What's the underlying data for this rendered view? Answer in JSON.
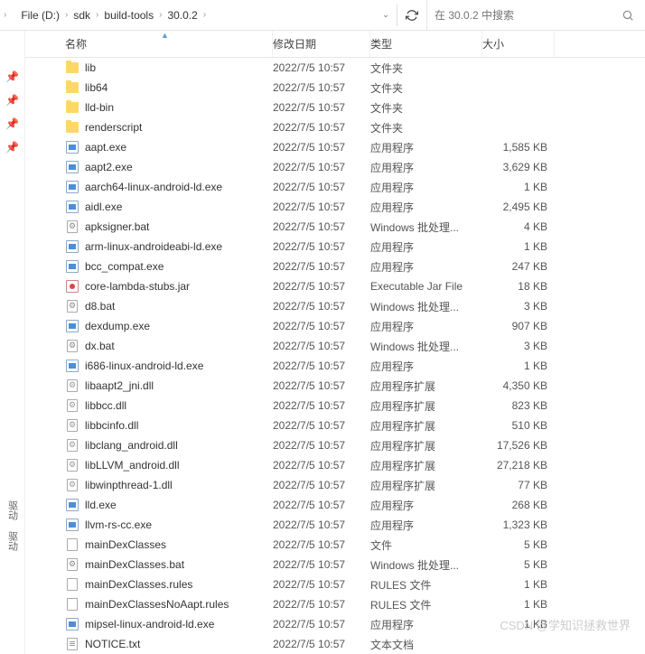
{
  "breadcrumb": [
    "File (D:)",
    "sdk",
    "build-tools",
    "30.0.2"
  ],
  "search": {
    "placeholder": "在 30.0.2 中搜索"
  },
  "columns": {
    "name": "名称",
    "date": "修改日期",
    "type": "类型",
    "size": "大小"
  },
  "quickaccess": {
    "label1": "驱动",
    "label2": "驱动"
  },
  "watermark": "CSDN @学知识拯救世界",
  "files": [
    {
      "icon": "folder",
      "name": "lib",
      "date": "2022/7/5 10:57",
      "type": "文件夹",
      "size": ""
    },
    {
      "icon": "folder",
      "name": "lib64",
      "date": "2022/7/5 10:57",
      "type": "文件夹",
      "size": ""
    },
    {
      "icon": "folder",
      "name": "lld-bin",
      "date": "2022/7/5 10:57",
      "type": "文件夹",
      "size": ""
    },
    {
      "icon": "folder",
      "name": "renderscript",
      "date": "2022/7/5 10:57",
      "type": "文件夹",
      "size": ""
    },
    {
      "icon": "exe",
      "name": "aapt.exe",
      "date": "2022/7/5 10:57",
      "type": "应用程序",
      "size": "1,585 KB"
    },
    {
      "icon": "exe",
      "name": "aapt2.exe",
      "date": "2022/7/5 10:57",
      "type": "应用程序",
      "size": "3,629 KB"
    },
    {
      "icon": "exe",
      "name": "aarch64-linux-android-ld.exe",
      "date": "2022/7/5 10:57",
      "type": "应用程序",
      "size": "1 KB"
    },
    {
      "icon": "exe",
      "name": "aidl.exe",
      "date": "2022/7/5 10:57",
      "type": "应用程序",
      "size": "2,495 KB"
    },
    {
      "icon": "bat",
      "name": "apksigner.bat",
      "date": "2022/7/5 10:57",
      "type": "Windows 批处理...",
      "size": "4 KB"
    },
    {
      "icon": "exe",
      "name": "arm-linux-androideabi-ld.exe",
      "date": "2022/7/5 10:57",
      "type": "应用程序",
      "size": "1 KB"
    },
    {
      "icon": "exe",
      "name": "bcc_compat.exe",
      "date": "2022/7/5 10:57",
      "type": "应用程序",
      "size": "247 KB"
    },
    {
      "icon": "jar",
      "name": "core-lambda-stubs.jar",
      "date": "2022/7/5 10:57",
      "type": "Executable Jar File",
      "size": "18 KB"
    },
    {
      "icon": "bat",
      "name": "d8.bat",
      "date": "2022/7/5 10:57",
      "type": "Windows 批处理...",
      "size": "3 KB"
    },
    {
      "icon": "exe",
      "name": "dexdump.exe",
      "date": "2022/7/5 10:57",
      "type": "应用程序",
      "size": "907 KB"
    },
    {
      "icon": "bat",
      "name": "dx.bat",
      "date": "2022/7/5 10:57",
      "type": "Windows 批处理...",
      "size": "3 KB"
    },
    {
      "icon": "exe",
      "name": "i686-linux-android-ld.exe",
      "date": "2022/7/5 10:57",
      "type": "应用程序",
      "size": "1 KB"
    },
    {
      "icon": "dll",
      "name": "libaapt2_jni.dll",
      "date": "2022/7/5 10:57",
      "type": "应用程序扩展",
      "size": "4,350 KB"
    },
    {
      "icon": "dll",
      "name": "libbcc.dll",
      "date": "2022/7/5 10:57",
      "type": "应用程序扩展",
      "size": "823 KB"
    },
    {
      "icon": "dll",
      "name": "libbcinfo.dll",
      "date": "2022/7/5 10:57",
      "type": "应用程序扩展",
      "size": "510 KB"
    },
    {
      "icon": "dll",
      "name": "libclang_android.dll",
      "date": "2022/7/5 10:57",
      "type": "应用程序扩展",
      "size": "17,526 KB"
    },
    {
      "icon": "dll",
      "name": "libLLVM_android.dll",
      "date": "2022/7/5 10:57",
      "type": "应用程序扩展",
      "size": "27,218 KB"
    },
    {
      "icon": "dll",
      "name": "libwinpthread-1.dll",
      "date": "2022/7/5 10:57",
      "type": "应用程序扩展",
      "size": "77 KB"
    },
    {
      "icon": "exe",
      "name": "lld.exe",
      "date": "2022/7/5 10:57",
      "type": "应用程序",
      "size": "268 KB"
    },
    {
      "icon": "exe",
      "name": "llvm-rs-cc.exe",
      "date": "2022/7/5 10:57",
      "type": "应用程序",
      "size": "1,323 KB"
    },
    {
      "icon": "file",
      "name": "mainDexClasses",
      "date": "2022/7/5 10:57",
      "type": "文件",
      "size": "5 KB"
    },
    {
      "icon": "bat",
      "name": "mainDexClasses.bat",
      "date": "2022/7/5 10:57",
      "type": "Windows 批处理...",
      "size": "5 KB"
    },
    {
      "icon": "file",
      "name": "mainDexClasses.rules",
      "date": "2022/7/5 10:57",
      "type": "RULES 文件",
      "size": "1 KB"
    },
    {
      "icon": "file",
      "name": "mainDexClassesNoAapt.rules",
      "date": "2022/7/5 10:57",
      "type": "RULES 文件",
      "size": "1 KB"
    },
    {
      "icon": "exe",
      "name": "mipsel-linux-android-ld.exe",
      "date": "2022/7/5 10:57",
      "type": "应用程序",
      "size": "1 KB"
    },
    {
      "icon": "txt",
      "name": "NOTICE.txt",
      "date": "2022/7/5 10:57",
      "type": "文本文档",
      "size": ""
    }
  ]
}
